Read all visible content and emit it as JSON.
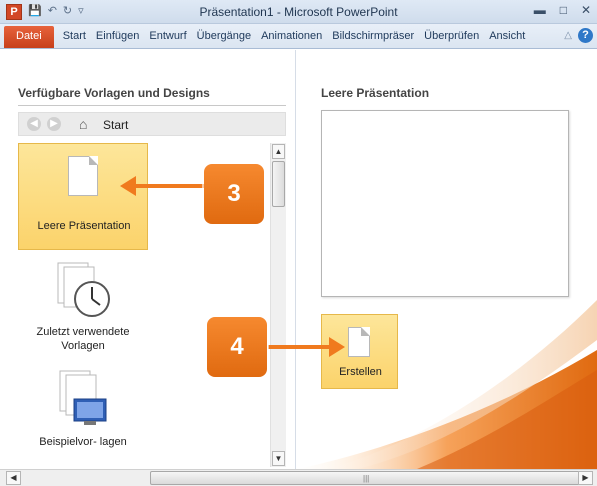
{
  "titlebar": {
    "app_icon_letter": "P",
    "title": "Präsentation1  -  Microsoft PowerPoint",
    "icons": [
      "save-icon",
      "undo-icon",
      "redo-icon",
      "customize-qat-icon"
    ],
    "window_buttons": [
      "minimize-icon",
      "restore-icon",
      "close-icon"
    ]
  },
  "ribbon": {
    "tabs": [
      "Datei",
      "Start",
      "Einfügen",
      "Entwurf",
      "Übergänge",
      "Animationen",
      "Bildschirmpräser",
      "Überprüfen",
      "Ansicht"
    ],
    "active_tab": "Datei",
    "help_glyph": "?"
  },
  "left": {
    "section_title": "Verfügbare Vorlagen und Designs",
    "nav": {
      "back": "back-arrow-icon",
      "forward": "forward-arrow-icon",
      "home_icon": "home-icon",
      "label": "Start"
    },
    "tiles": [
      {
        "label": "Leere Präsentation",
        "icon": "blank-document-icon",
        "selected": true
      },
      {
        "label": "Zuletzt verwendete Vorlagen",
        "icon": "recent-templates-clock-icon",
        "selected": false
      },
      {
        "label": "Beispielvor- lagen",
        "icon": "sample-templates-icon",
        "selected": false
      }
    ]
  },
  "right": {
    "preview_title": "Leere Präsentation",
    "create_label": "Erstellen"
  },
  "callouts": [
    {
      "number": "3",
      "color": "#f07a1e"
    },
    {
      "number": "4",
      "color": "#f07a1e"
    }
  ],
  "colors": {
    "accent_orange": "#f07a1e",
    "selection_yellow": "#fbd36b",
    "file_tab": "#d24726"
  }
}
